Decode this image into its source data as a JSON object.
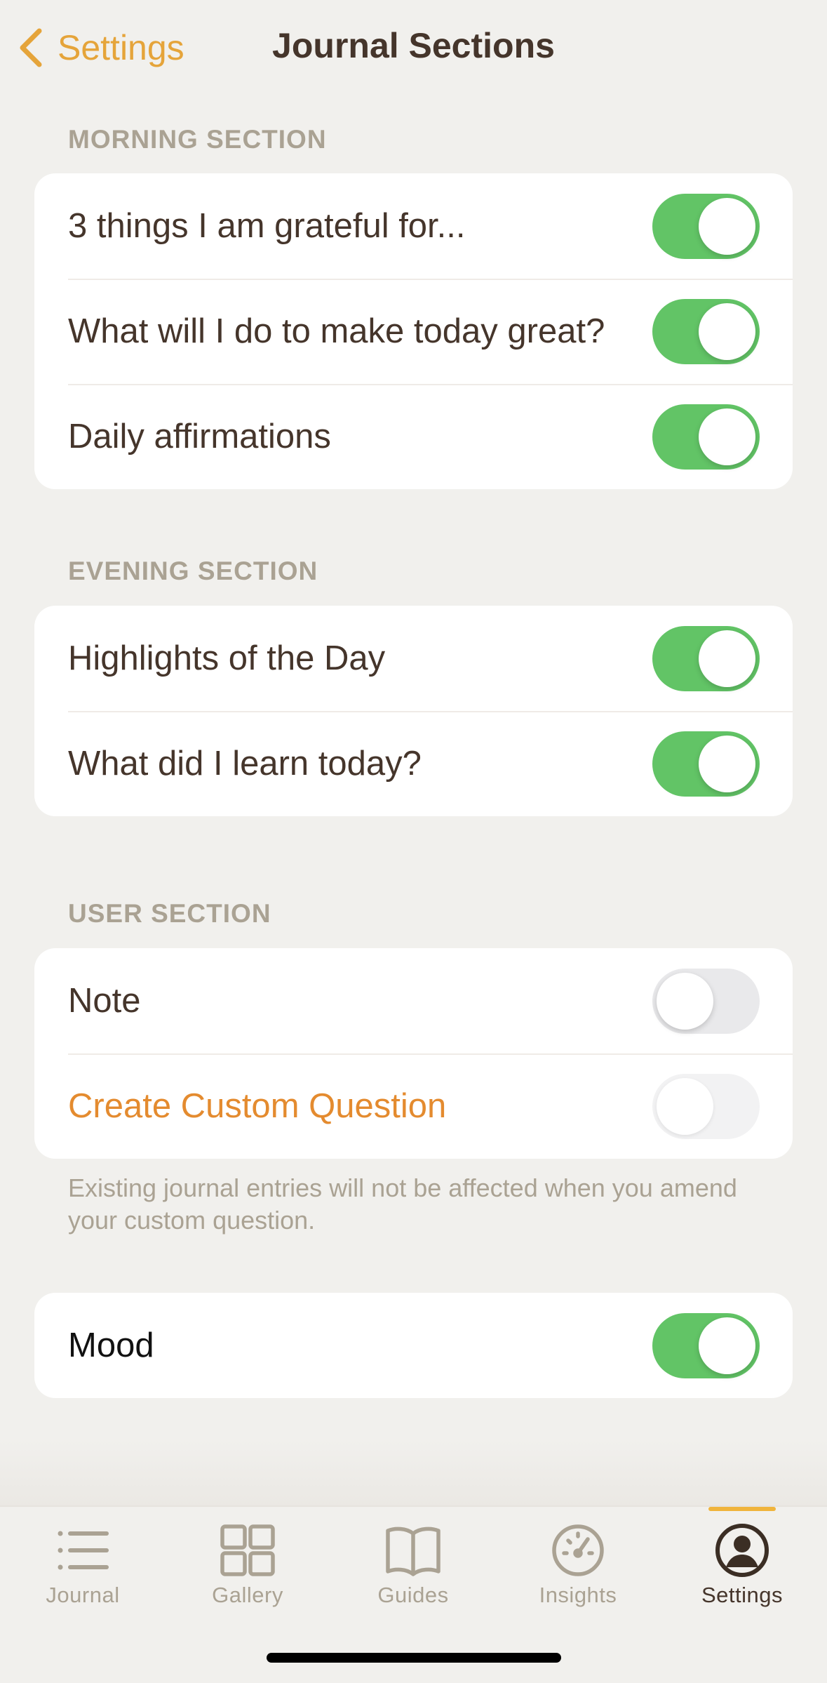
{
  "nav": {
    "back_label": "Settings",
    "title": "Journal Sections"
  },
  "morning": {
    "header": "MORNING SECTION",
    "rows": [
      {
        "label": "3 things I am grateful for...",
        "toggle": "on"
      },
      {
        "label": "What will I do to make today great?",
        "toggle": "on"
      },
      {
        "label": "Daily affirmations",
        "toggle": "on"
      }
    ]
  },
  "evening": {
    "header": "EVENING SECTION",
    "rows": [
      {
        "label": "Highlights of the Day",
        "toggle": "on"
      },
      {
        "label": "What did I learn today?",
        "toggle": "on"
      }
    ]
  },
  "user": {
    "header": "USER SECTION",
    "rows": [
      {
        "label": "Note",
        "toggle": "off"
      },
      {
        "label": "Create Custom Question",
        "toggle": "off-disabled"
      }
    ],
    "footnote": "Existing journal entries will not be affected when you amend your custom question."
  },
  "mood": {
    "rows": [
      {
        "label": "Mood",
        "toggle": "on"
      }
    ]
  },
  "tabs": [
    {
      "label": "Journal",
      "icon": "list-icon",
      "active": false
    },
    {
      "label": "Gallery",
      "icon": "grid-icon",
      "active": false
    },
    {
      "label": "Guides",
      "icon": "book-icon",
      "active": false
    },
    {
      "label": "Insights",
      "icon": "gauge-icon",
      "active": false
    },
    {
      "label": "Settings",
      "icon": "person-circle-icon",
      "active": true
    }
  ],
  "colors": {
    "accent": "#e5a43a",
    "accent_text": "#e48b2f",
    "toggle_on": "#62c466",
    "background": "#f1f0ed",
    "text_primary": "#45352b",
    "text_secondary": "#aaa293"
  }
}
